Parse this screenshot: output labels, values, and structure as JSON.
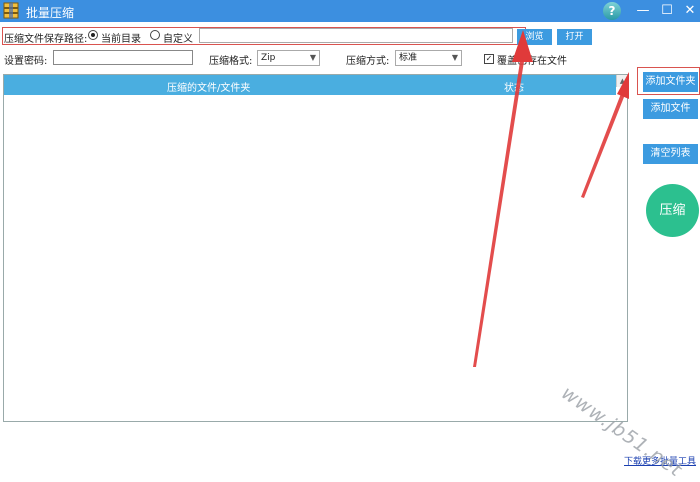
{
  "window": {
    "title": "批量压缩",
    "minimize": "—",
    "maximize": "☐",
    "close": "✕",
    "help": "?"
  },
  "save_path": {
    "label": "压缩文件保存路径:",
    "options": [
      {
        "label": "当前目录",
        "checked": true
      },
      {
        "label": "自定义",
        "checked": false
      }
    ],
    "path_value": "",
    "browse_label": "浏览",
    "open_label": "打开"
  },
  "settings": {
    "password_label": "设置密码:",
    "password_value": "",
    "format_label": "压缩格式:",
    "format_value": "Zip",
    "method_label": "压缩方式:",
    "method_value": "标准",
    "overwrite_label": "覆盖已存在文件",
    "overwrite_checked": true
  },
  "table": {
    "columns": [
      "压缩的文件/文件夹",
      "状态"
    ],
    "rows": []
  },
  "side_buttons": {
    "add_folder": "添加文件夹",
    "add_file": "添加文件",
    "clear_list": "清空列表",
    "compress": "压缩"
  },
  "footer_link": "下载更多批量工具",
  "watermark": "www.jb51.net",
  "colors": {
    "titlebar": "#3c8fe0",
    "button": "#3c9be0",
    "table_header": "#4aaee0",
    "compress": "#2cc08f",
    "annotation": "#e03a3a"
  },
  "icons": [
    "app-icon",
    "help-icon",
    "minimize-icon",
    "maximize-icon",
    "close-icon",
    "checkbox-icon"
  ]
}
